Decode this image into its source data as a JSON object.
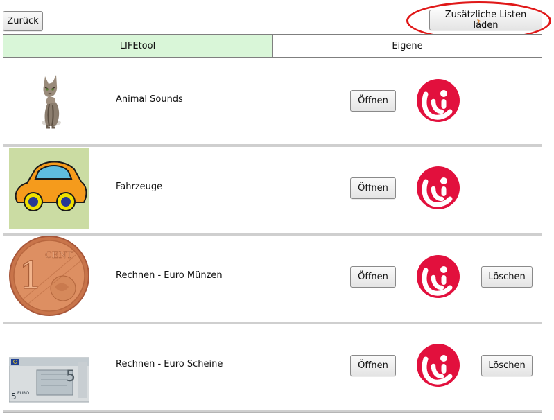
{
  "toolbar": {
    "back_label": "Zurück",
    "load_label": "Zusätzliche Listen laden"
  },
  "tabs": [
    {
      "label": "LIFEtool",
      "active": true
    },
    {
      "label": "Eigene",
      "active": false
    }
  ],
  "lists": [
    {
      "title": "Animal Sounds",
      "open_label": "Öffnen",
      "thumbnail": "cat-image"
    },
    {
      "title": "Fahrzeuge",
      "open_label": "Öffnen",
      "thumbnail": "car-image"
    },
    {
      "title": "Rechnen - Euro Münzen",
      "open_label": "Öffnen",
      "delete_label": "Löschen",
      "thumbnail": "euro-coin-image"
    },
    {
      "title": "Rechnen - Euro Scheine",
      "open_label": "Öffnen",
      "delete_label": "Löschen",
      "thumbnail": "euro-banknote-image"
    }
  ],
  "colors": {
    "active_tab": "#d9f6d8",
    "brand_red": "#e2103d",
    "highlight_annotation": "#e01818"
  }
}
